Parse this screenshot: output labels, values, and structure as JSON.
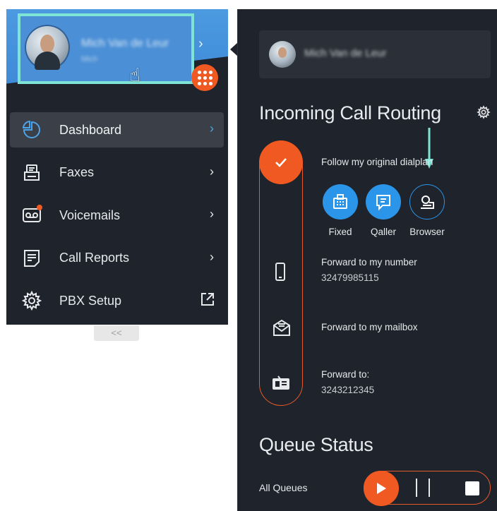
{
  "sidebar": {
    "user": {
      "name": "Mich Van de Leur",
      "subtitle": "Mich"
    },
    "items": [
      {
        "label": "Dashboard",
        "icon": "pie-chart-icon",
        "active": true
      },
      {
        "label": "Faxes",
        "icon": "fax-icon"
      },
      {
        "label": "Voicemails",
        "icon": "voicemail-icon",
        "badge": true
      },
      {
        "label": "Call Reports",
        "icon": "report-icon"
      },
      {
        "label": "PBX Setup",
        "icon": "gear-icon",
        "external": true
      }
    ],
    "collapse_label": "<<"
  },
  "panel": {
    "user_name": "Mich Van de Leur",
    "routing_title": "Incoming Call Routing",
    "options": {
      "dialplan": "Follow my original dialplan",
      "number_label": "Forward to my number",
      "number_value": "32479985115",
      "mailbox": "Forward to my mailbox",
      "forward_label": "Forward to:",
      "forward_value": "3243212345"
    },
    "devices": [
      {
        "label": "Fixed",
        "icon": "fixed-phone-icon"
      },
      {
        "label": "Qaller",
        "icon": "qaller-chat-icon"
      },
      {
        "label": "Browser",
        "icon": "browser-phone-icon"
      }
    ],
    "queue_title": "Queue Status",
    "queue_label": "All Queues"
  },
  "colors": {
    "accent_orange": "#f05a22",
    "accent_blue": "#2b95e9",
    "highlight_teal": "#7fe3d5",
    "panel_bg": "#1f232b"
  }
}
